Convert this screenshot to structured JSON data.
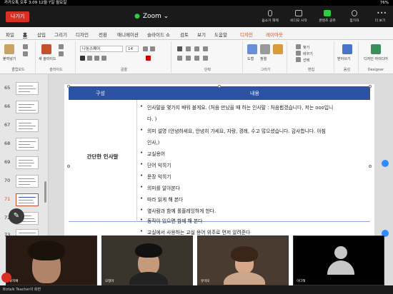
{
  "status_bar": {
    "left": "카카오톡  오후 3:09  12월 7일 월요일",
    "right": "76%"
  },
  "zoom": {
    "leave_label": "나가기",
    "title": "Zoom",
    "buttons": [
      {
        "label": "음소거 해제",
        "icon": "mic-off-icon"
      },
      {
        "label": "비디오 시작",
        "icon": "video-off-icon"
      },
      {
        "label": "콘텐츠 공유",
        "icon": "share-content-icon"
      },
      {
        "label": "참가자",
        "icon": "participants-icon"
      },
      {
        "label": "더 보기",
        "icon": "more-icon"
      }
    ]
  },
  "ribbon": {
    "tabs": [
      "파일",
      "홈",
      "삽입",
      "그리기",
      "디자인",
      "전환",
      "애니메이션",
      "슬라이드 쇼",
      "검토",
      "보기",
      "도움말",
      "디자인",
      "레이아웃"
    ],
    "groups": [
      "클립보드",
      "슬라이드",
      "글꼴",
      "단락",
      "그리기",
      "편집",
      "음성",
      "Designer"
    ],
    "font_name": "나눔스퀘어",
    "font_size": "14",
    "buttons": [
      "붙여넣기",
      "새 슬라이드",
      "도형",
      "정렬",
      "빠른 스타일",
      "찾기",
      "바꾸기",
      "선택",
      "받아쓰기",
      "디자인 아이디어"
    ]
  },
  "thumbnails": [
    "65",
    "66",
    "67",
    "68",
    "69",
    "70",
    "71",
    "72",
    "73"
  ],
  "slide": {
    "header": [
      "구성",
      "내용"
    ],
    "row_label": "간단한 인사말",
    "bullets": [
      {
        "text": "인사말을 몇가지 배워 볼게요. (처음 만났을 때 하는 인사말 : 처음뵙겠습니다, 저는 ooo입니"
      },
      {
        "text": "다. )",
        "cont": true
      },
      {
        "text": "의미 설명    (안녕하세요, 안녕히 가세요, 자랑, 경례, 수고 많으셨습니다.  감사합니다. 아침"
      },
      {
        "text": "인사,)",
        "cont": true
      },
      {
        "text": "                 교실용어"
      },
      {
        "text": "단어 익히기"
      },
      {
        "text": "문장 익히기"
      },
      {
        "text": "의미를 알아본다"
      },
      {
        "text": "따라 읽게 해 본다"
      },
      {
        "text": "옆사람과 함께 롤플레잉하게 한다."
      },
      {
        "text": "동작이 있으면 함께 해 본다"
      }
    ],
    "next_row_bullet": "교실에서 사용하는 교실 용어 위주로 먼저 알려준다"
  },
  "participants": [
    {
      "name": "류지예"
    },
    {
      "name": "모정아"
    },
    {
      "name": "유미오"
    },
    {
      "name": "이다해"
    }
  ],
  "footer": "Biztalk Teacher의 화면"
}
